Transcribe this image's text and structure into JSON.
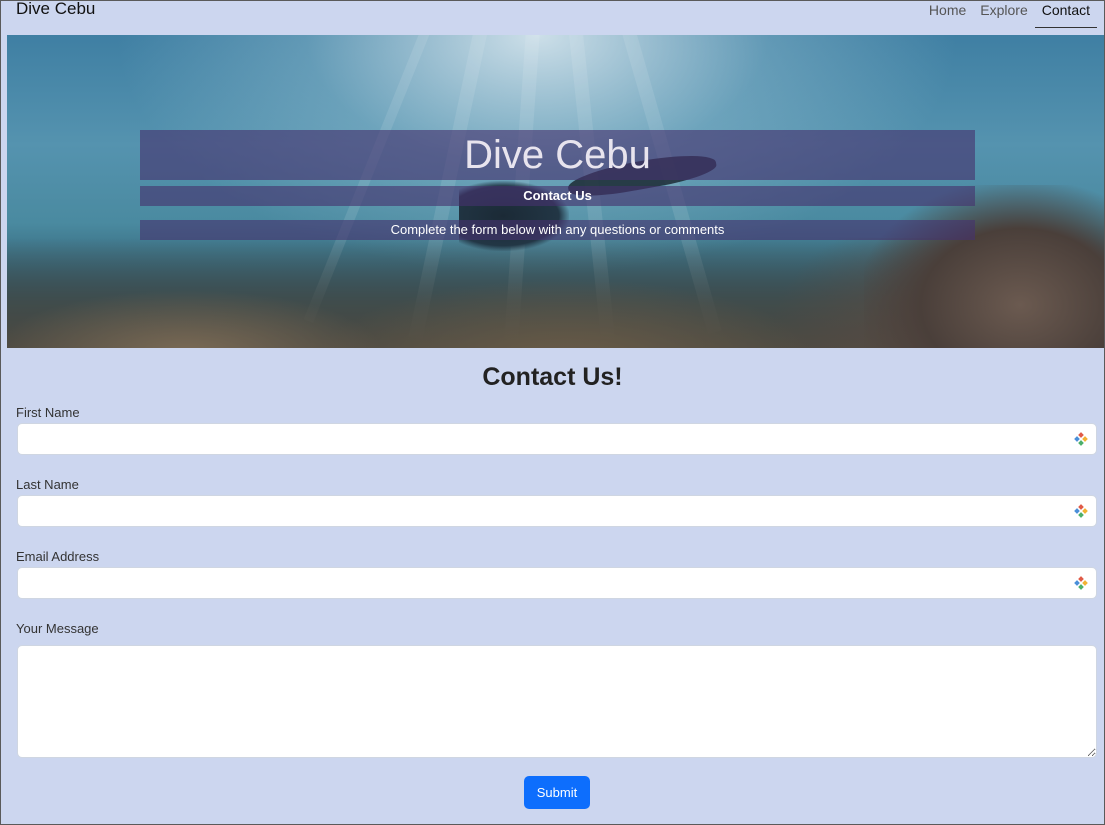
{
  "navbar": {
    "brand": "Dive Cebu",
    "links": [
      {
        "label": "Home"
      },
      {
        "label": "Explore"
      },
      {
        "label": "Contact",
        "active": true
      }
    ]
  },
  "hero": {
    "title": "Dive Cebu",
    "subtitle": "Contact Us",
    "description": "Complete the form below with any questions or comments",
    "image": "underwater scuba diver over coral reef"
  },
  "form": {
    "heading": "Contact Us!",
    "fields": [
      {
        "label": "First Name",
        "value": ""
      },
      {
        "label": "Last Name",
        "value": ""
      },
      {
        "label": "Email Address",
        "value": ""
      },
      {
        "label": "Your Message",
        "value": ""
      }
    ],
    "submit_label": "Submit",
    "autofill_icon": "autofill-icon"
  },
  "colors": {
    "page_background": "#ccd6ef",
    "hero_band": "#46326e",
    "submit_button": "#0d6efd"
  }
}
